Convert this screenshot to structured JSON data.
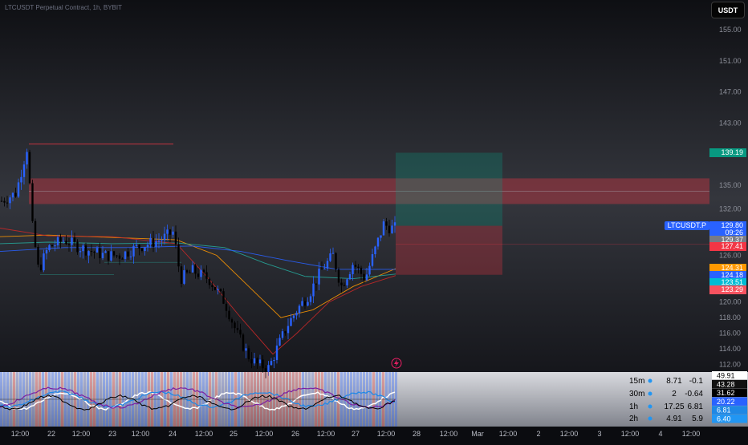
{
  "header": {
    "title": "LTCUSDT Perpetual Contract, 1h, BYBIT",
    "currency_button": "USDT"
  },
  "chart_data": {
    "type": "candlestick",
    "symbol": "LTCUSDT.P",
    "timeframe": "1h",
    "exchange": "BYBIT",
    "ylim": [
      111,
      158
    ],
    "y_ticks": [
      "155.00",
      "151.00",
      "147.00",
      "143.00",
      "135.00",
      "132.00",
      "126.00",
      "120.00",
      "118.00",
      "116.00",
      "114.00",
      "112.00"
    ],
    "x_ticks": [
      "12:00",
      "22",
      "12:00",
      "23",
      "12:00",
      "24",
      "12:00",
      "25",
      "12:00",
      "26",
      "12:00",
      "27",
      "12:00",
      "28",
      "12:00",
      "Mar",
      "12:00",
      "2",
      "12:00",
      "3",
      "12:00",
      "4",
      "12:00"
    ],
    "price_labels": [
      {
        "text": "139.19",
        "value": 139.19,
        "color": "#089981"
      },
      {
        "text": "LTCUSDT.P",
        "value": 129.8,
        "color": "#2962ff",
        "left": true
      },
      {
        "text": "129.80",
        "value": 129.8,
        "color": "#2962ff"
      },
      {
        "text": "09:26",
        "value": 128.9,
        "color": "#2962ff"
      },
      {
        "text": "129.37",
        "value": 128.0,
        "color": "#787b86"
      },
      {
        "text": "127.41",
        "value": 127.1,
        "color": "#f23645"
      },
      {
        "text": "124.31",
        "value": 124.3,
        "color": "#ff9800"
      },
      {
        "text": "124.18",
        "value": 123.4,
        "color": "#2962ff"
      },
      {
        "text": "123.51",
        "value": 122.5,
        "color": "#00bcd4"
      },
      {
        "text": "123.29",
        "value": 121.6,
        "color": "#f7525f"
      }
    ],
    "zones": [
      {
        "name": "resistance",
        "y_low": 132.6,
        "y_high": 135.9,
        "color": "#f23645"
      }
    ],
    "position": {
      "entry": 129.8,
      "target": 139.19,
      "stop": 123.5
    },
    "oscillator_table": [
      {
        "tf": "15m",
        "a": "8.71",
        "b": "-0.1"
      },
      {
        "tf": "30m",
        "a": "2",
        "b": "-0.64"
      },
      {
        "tf": "1h",
        "a": "17.25",
        "b": "6.81"
      },
      {
        "tf": "2h",
        "a": "4.91",
        "b": "5.9"
      }
    ],
    "oscillator_scale": [
      {
        "text": "49.91",
        "bg": "#ffffff",
        "fg": "#000000"
      },
      {
        "text": "43.28",
        "bg": "#111111",
        "fg": "#ffffff"
      },
      {
        "text": "31.62",
        "bg": "#000000",
        "fg": "#ffffff"
      },
      {
        "text": "20.22",
        "bg": "#2962ff",
        "fg": "#ffffff"
      },
      {
        "text": "6.81",
        "bg": "#1e88e5",
        "fg": "#ffffff"
      },
      {
        "text": "6.40",
        "bg": "#2196f3",
        "fg": "#ffffff"
      }
    ],
    "colors": {
      "up": "#2962ff",
      "down": "#000000",
      "ema_orange": "#ff9800",
      "ema_teal": "#26a69a",
      "ema_red": "#c62828",
      "ema_blue": "#2962ff"
    }
  }
}
